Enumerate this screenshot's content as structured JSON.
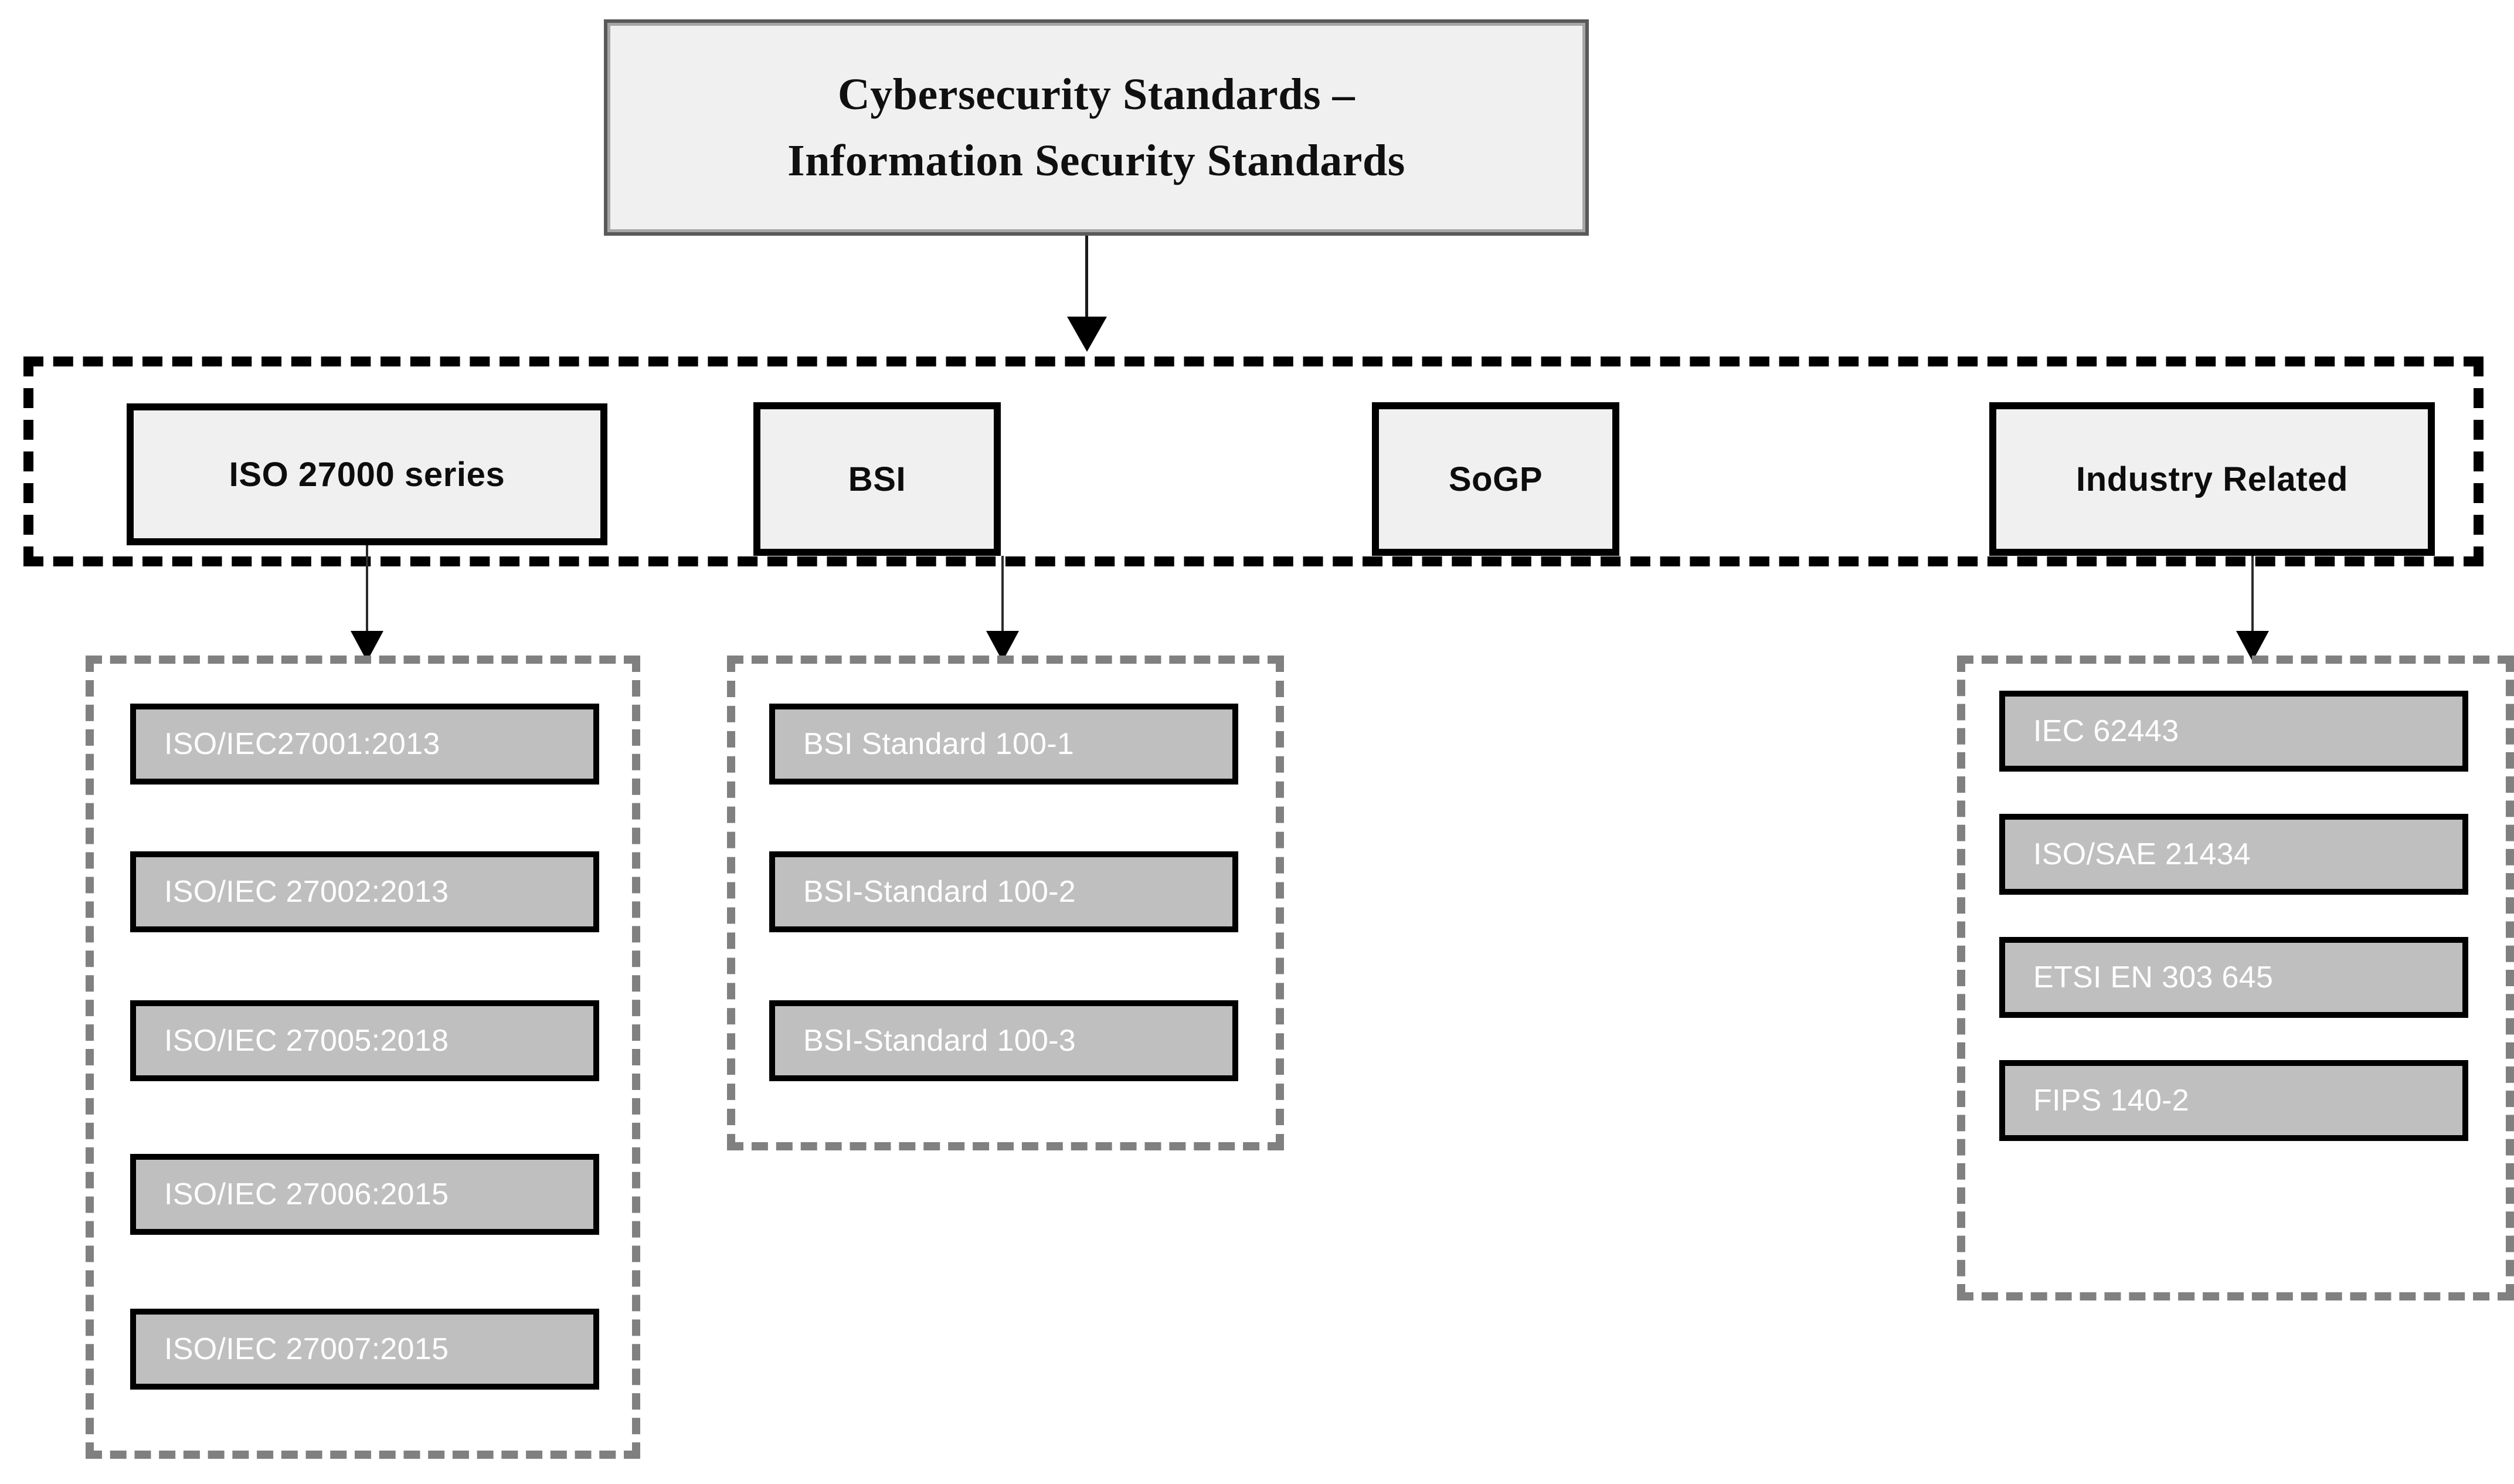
{
  "diagram": {
    "title": {
      "line1": "Cybersecurity Standards –",
      "line2": "Information Security Standards"
    },
    "categories": [
      {
        "id": "iso-27000-series",
        "label": "ISO 27000 series"
      },
      {
        "id": "bsi",
        "label": "BSI"
      },
      {
        "id": "sogp",
        "label": "SoGP"
      },
      {
        "id": "industry-related",
        "label": "Industry Related"
      }
    ],
    "groups": {
      "iso": {
        "items": [
          {
            "label": "ISO/IEC27001:2013"
          },
          {
            "label": "ISO/IEC 27002:2013"
          },
          {
            "label": "ISO/IEC 27005:2018"
          },
          {
            "label": "ISO/IEC 27006:2015"
          },
          {
            "label": "ISO/IEC 27007:2015"
          }
        ]
      },
      "bsi": {
        "items": [
          {
            "label": "BSI Standard 100-1"
          },
          {
            "label": "BSI-Standard 100-2"
          },
          {
            "label": "BSI-Standard 100-3"
          }
        ]
      },
      "industry": {
        "items": [
          {
            "label": "IEC 62443"
          },
          {
            "label": "ISO/SAE 21434"
          },
          {
            "label": "ETSI EN 303 645"
          },
          {
            "label": "FIPS 140-2"
          }
        ]
      }
    },
    "colors": {
      "title_fill": "#F0F0F0",
      "title_border_outer": "#A6A6A6",
      "title_border_inner": "#595959",
      "category_fill": "#F0F0F0",
      "category_border": "#000000",
      "item_fill": "#BFBFBF",
      "item_border": "#000000",
      "item_text": "#FFFFFF",
      "band_dash": "#000000",
      "group_dash": "#808080",
      "connector": "#1A1A1A",
      "background": "#FFFFFF"
    }
  }
}
